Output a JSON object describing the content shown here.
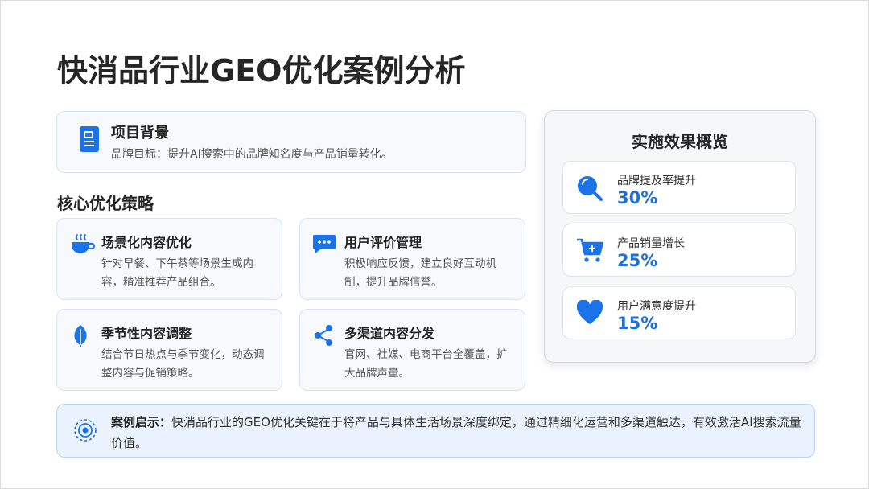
{
  "title": "快消品行业GEO优化案例分析",
  "background": {
    "title": "项目背景",
    "text": "品牌目标：提升AI搜索中的品牌知名度与产品销量转化。",
    "icon": "document-icon"
  },
  "strategy_title": "核心优化策略",
  "strategies": [
    {
      "title": "场景化内容优化",
      "text": "针对早餐、下午茶等场景生成内容，精准推荐产品组合。",
      "icon": "coffee-cup-icon"
    },
    {
      "title": "用户评价管理",
      "text": "积极响应反馈，建立良好互动机制，提升品牌信誉。",
      "icon": "chat-bubble-icon"
    },
    {
      "title": "季节性内容调整",
      "text": "结合节日热点与季节变化，动态调整内容与促销策略。",
      "icon": "leaf-icon"
    },
    {
      "title": "多渠道内容分发",
      "text": "官网、社媒、电商平台全覆盖，扩大品牌声量。",
      "icon": "share-icon"
    }
  ],
  "overview": {
    "title": "实施效果概览",
    "metrics": [
      {
        "label": "品牌提及率提升",
        "value": "30%",
        "icon": "search-icon"
      },
      {
        "label": "产品销量增长",
        "value": "25%",
        "icon": "cart-icon"
      },
      {
        "label": "用户满意度提升",
        "value": "15%",
        "icon": "heart-icon"
      }
    ]
  },
  "insight": {
    "label": "案例启示：",
    "text": "快消品行业的GEO优化关键在于将产品与具体生活场景深度绑定，通过精细化运营和多渠道触达，有效激活AI搜索流量价值。",
    "icon": "target-icon"
  },
  "colors": {
    "accent": "#1d6fdc",
    "icon_blue": "#1a73e8",
    "card_border": "#d7e3f3"
  }
}
